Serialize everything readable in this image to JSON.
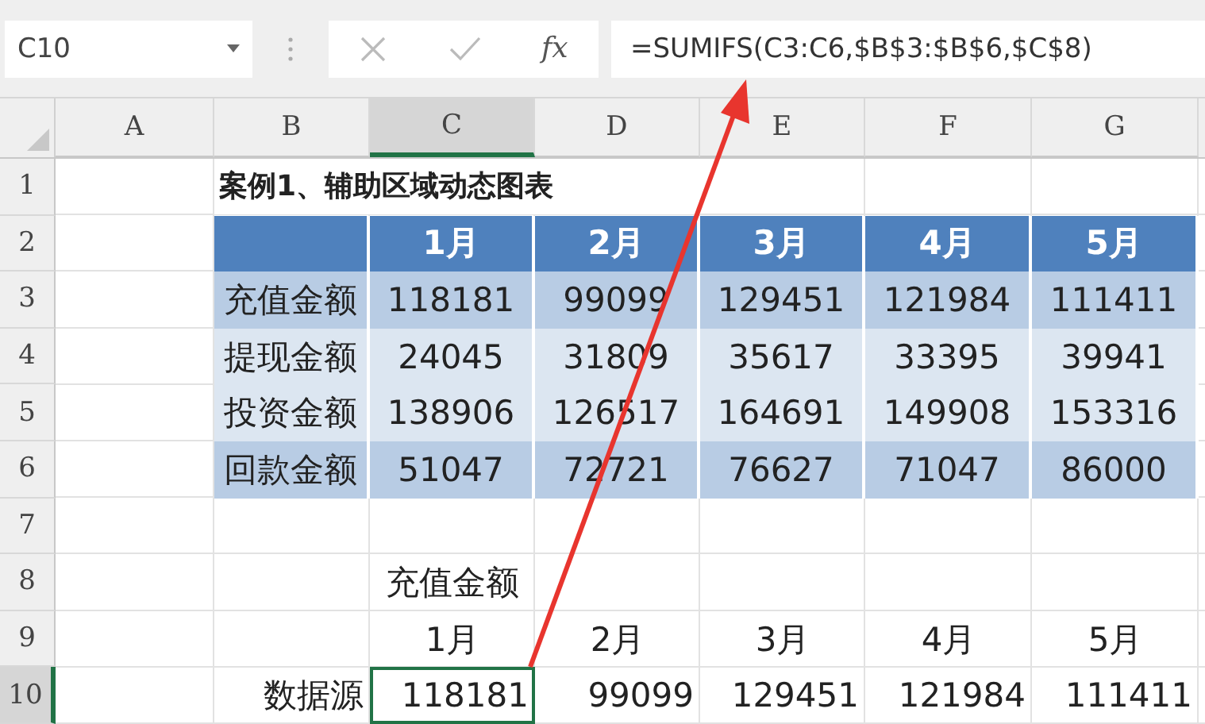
{
  "name_box": {
    "value": "C10"
  },
  "formula_bar": {
    "fx_label": "fx",
    "formula": "=SUMIFS(C3:C6,$B$3:$B$6,$C$8)"
  },
  "columns": [
    {
      "label": "A",
      "selected": false
    },
    {
      "label": "B",
      "selected": false
    },
    {
      "label": "C",
      "selected": true
    },
    {
      "label": "D",
      "selected": false
    },
    {
      "label": "E",
      "selected": false
    },
    {
      "label": "F",
      "selected": false
    },
    {
      "label": "G",
      "selected": false
    }
  ],
  "rows": [
    {
      "number": "1",
      "selected": false,
      "cells": [
        {
          "kind": "empty"
        },
        {
          "kind": "title",
          "text": "案例1、辅助区域动态图表"
        },
        {
          "kind": "empty"
        },
        {
          "kind": "empty"
        },
        {
          "kind": "empty"
        },
        {
          "kind": "empty"
        },
        {
          "kind": "empty"
        }
      ]
    },
    {
      "number": "2",
      "selected": false,
      "cells": [
        {
          "kind": "empty"
        },
        {
          "kind": "header"
        },
        {
          "kind": "header",
          "text": "1月"
        },
        {
          "kind": "header",
          "text": "2月"
        },
        {
          "kind": "header",
          "text": "3月"
        },
        {
          "kind": "header",
          "text": "4月"
        },
        {
          "kind": "header",
          "text": "5月"
        }
      ]
    },
    {
      "number": "3",
      "selected": false,
      "cells": [
        {
          "kind": "empty"
        },
        {
          "kind": "band-dark",
          "text": "充值金额"
        },
        {
          "kind": "band-dark",
          "text": "118181"
        },
        {
          "kind": "band-dark",
          "text": "99099"
        },
        {
          "kind": "band-dark",
          "text": "129451"
        },
        {
          "kind": "band-dark",
          "text": "121984"
        },
        {
          "kind": "band-dark",
          "text": "111411"
        }
      ]
    },
    {
      "number": "4",
      "selected": false,
      "cells": [
        {
          "kind": "empty"
        },
        {
          "kind": "band-light",
          "text": "提现金额"
        },
        {
          "kind": "band-light",
          "text": "24045"
        },
        {
          "kind": "band-light",
          "text": "31809"
        },
        {
          "kind": "band-light",
          "text": "35617"
        },
        {
          "kind": "band-light",
          "text": "33395"
        },
        {
          "kind": "band-light",
          "text": "39941"
        }
      ]
    },
    {
      "number": "5",
      "selected": false,
      "cells": [
        {
          "kind": "empty"
        },
        {
          "kind": "band-light",
          "text": "投资金额"
        },
        {
          "kind": "band-light",
          "text": "138906"
        },
        {
          "kind": "band-light",
          "text": "126517"
        },
        {
          "kind": "band-light",
          "text": "164691"
        },
        {
          "kind": "band-light",
          "text": "149908"
        },
        {
          "kind": "band-light",
          "text": "153316"
        }
      ]
    },
    {
      "number": "6",
      "selected": false,
      "cells": [
        {
          "kind": "empty"
        },
        {
          "kind": "band-dark",
          "text": "回款金额"
        },
        {
          "kind": "band-dark",
          "text": "51047"
        },
        {
          "kind": "band-dark",
          "text": "72721"
        },
        {
          "kind": "band-dark",
          "text": "76627"
        },
        {
          "kind": "band-dark",
          "text": "71047"
        },
        {
          "kind": "band-dark",
          "text": "86000"
        }
      ]
    },
    {
      "number": "7",
      "selected": false,
      "cells": [
        {
          "kind": "empty"
        },
        {
          "kind": "empty"
        },
        {
          "kind": "empty"
        },
        {
          "kind": "empty"
        },
        {
          "kind": "empty"
        },
        {
          "kind": "empty"
        },
        {
          "kind": "empty"
        }
      ]
    },
    {
      "number": "8",
      "selected": false,
      "cells": [
        {
          "kind": "empty"
        },
        {
          "kind": "empty"
        },
        {
          "kind": "center",
          "text": "充值金额"
        },
        {
          "kind": "empty"
        },
        {
          "kind": "empty"
        },
        {
          "kind": "empty"
        },
        {
          "kind": "empty"
        }
      ]
    },
    {
      "number": "9",
      "selected": false,
      "cells": [
        {
          "kind": "empty"
        },
        {
          "kind": "empty"
        },
        {
          "kind": "center",
          "text": "1月"
        },
        {
          "kind": "center",
          "text": "2月"
        },
        {
          "kind": "center",
          "text": "3月"
        },
        {
          "kind": "center",
          "text": "4月"
        },
        {
          "kind": "center",
          "text": "5月"
        }
      ]
    },
    {
      "number": "10",
      "selected": true,
      "cells": [
        {
          "kind": "empty"
        },
        {
          "kind": "right",
          "text": "数据源"
        },
        {
          "kind": "right",
          "text": "118181"
        },
        {
          "kind": "right",
          "text": "99099"
        },
        {
          "kind": "right",
          "text": "129451"
        },
        {
          "kind": "right",
          "text": "121984"
        },
        {
          "kind": "right",
          "text": "111411"
        }
      ]
    }
  ]
}
